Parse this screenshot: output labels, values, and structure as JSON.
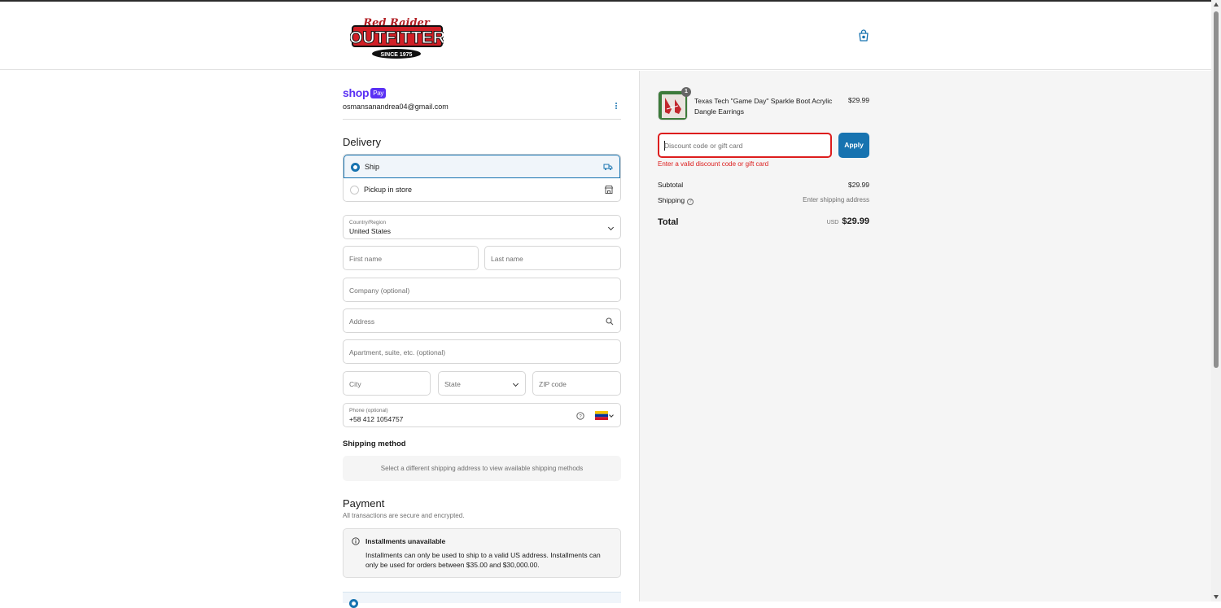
{
  "header": {
    "logo_top": "Red Raider",
    "logo_main": "OUTFITTER",
    "logo_since": "SINCE 1975",
    "cart_icon": "bag-icon"
  },
  "account": {
    "brand": "shop",
    "brand_badge": "Pay",
    "email": "osmansanandrea04@gmail.com"
  },
  "delivery": {
    "heading": "Delivery",
    "options": [
      {
        "label": "Ship",
        "icon": "truck-icon",
        "selected": true
      },
      {
        "label": "Pickup in store",
        "icon": "store-icon",
        "selected": false
      }
    ],
    "country_label": "Country/Region",
    "country_value": "United States",
    "first_name_placeholder": "First name",
    "last_name_placeholder": "Last name",
    "company_placeholder": "Company (optional)",
    "address_placeholder": "Address",
    "apartment_placeholder": "Apartment, suite, etc. (optional)",
    "city_placeholder": "City",
    "state_placeholder": "State",
    "zip_placeholder": "ZIP code",
    "phone_label": "Phone (optional)",
    "phone_value": "+58 412 1054757",
    "phone_flag": "venezuela-flag"
  },
  "shipping_method": {
    "heading": "Shipping method",
    "message": "Select a different shipping address to view available shipping methods"
  },
  "payment": {
    "heading": "Payment",
    "subtitle": "All transactions are secure and encrypted.",
    "notice_title": "Installments unavailable",
    "notice_body": "Installments can only be used to ship to a valid US address. Installments can only be used for orders between $35.00 and $30,000.00."
  },
  "summary": {
    "product_name": "Texas Tech \"Game Day\" Sparkle Boot Acrylic Dangle Earrings",
    "product_price": "$29.99",
    "quantity": "1",
    "discount_placeholder": "Discount code or gift card",
    "apply_label": "Apply",
    "error": "Enter a valid discount code or gift card",
    "subtotal_label": "Subtotal",
    "subtotal_value": "$29.99",
    "shipping_label": "Shipping",
    "shipping_value": "Enter shipping address",
    "total_label": "Total",
    "currency": "USD",
    "total_value": "$29.99"
  },
  "colors": {
    "accent": "#1773b0",
    "error": "#dd1d1d",
    "shop_pay": "#5a31f4"
  }
}
